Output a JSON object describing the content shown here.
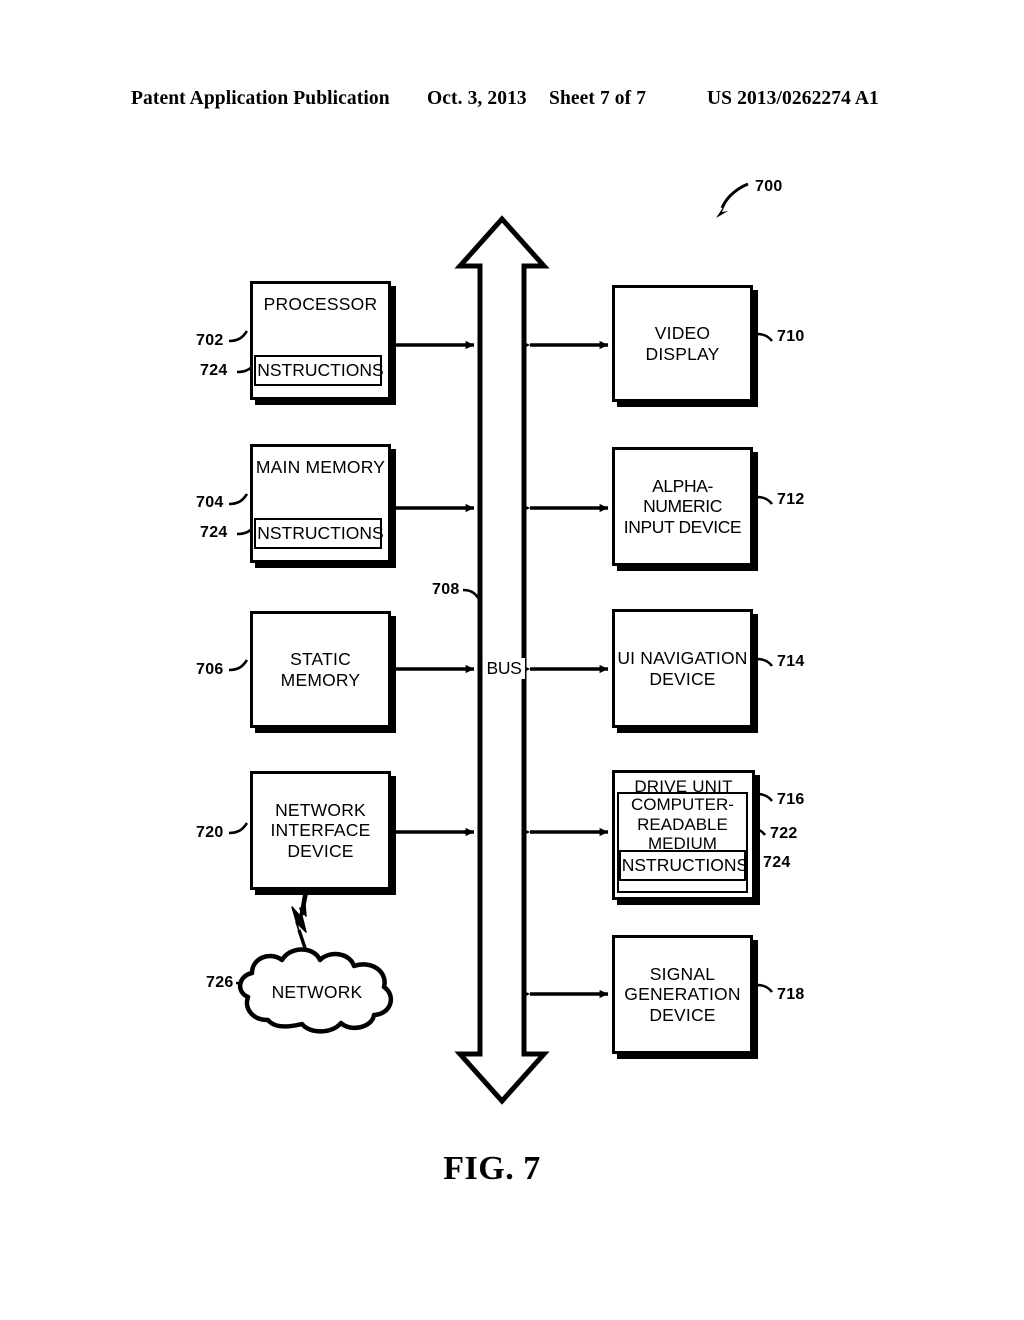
{
  "header": {
    "publication": "Patent Application Publication",
    "date": "Oct. 3, 2013",
    "sheet": "Sheet 7 of 7",
    "patent_number": "US 2013/0262274 A1"
  },
  "figure": {
    "caption": "FIG. 7",
    "system_ref": "700"
  },
  "bus": {
    "label": "BUS",
    "ref": "708"
  },
  "left_column": [
    {
      "title": "PROCESSOR",
      "ref": "702",
      "inner": {
        "title": "INSTRUCTIONS",
        "ref": "724"
      }
    },
    {
      "title": "MAIN MEMORY",
      "ref": "704",
      "inner": {
        "title": "INSTRUCTIONS",
        "ref": "724"
      }
    },
    {
      "title": "STATIC\nMEMORY",
      "ref": "706",
      "inner": null
    },
    {
      "title": "NETWORK\nINTERFACE\nDEVICE",
      "ref": "720",
      "inner": null
    }
  ],
  "right_column": [
    {
      "title": "VIDEO\nDISPLAY",
      "ref": "710"
    },
    {
      "title": "ALPHA-NUMERIC\nINPUT DEVICE",
      "ref": "712"
    },
    {
      "title": "UI NAVIGATION\nDEVICE",
      "ref": "714"
    },
    {
      "title": "DRIVE UNIT",
      "ref": "716",
      "inner": {
        "title": "COMPUTER-\nREADABLE\nMEDIUM",
        "ref": "722",
        "inner": {
          "title": "INSTRUCTIONS",
          "ref": "724"
        }
      }
    },
    {
      "title": "SIGNAL\nGENERATION\nDEVICE",
      "ref": "718"
    }
  ],
  "network": {
    "label": "NETWORK",
    "ref": "726"
  },
  "colors": {
    "ink": "#000000",
    "paper": "#ffffff"
  }
}
